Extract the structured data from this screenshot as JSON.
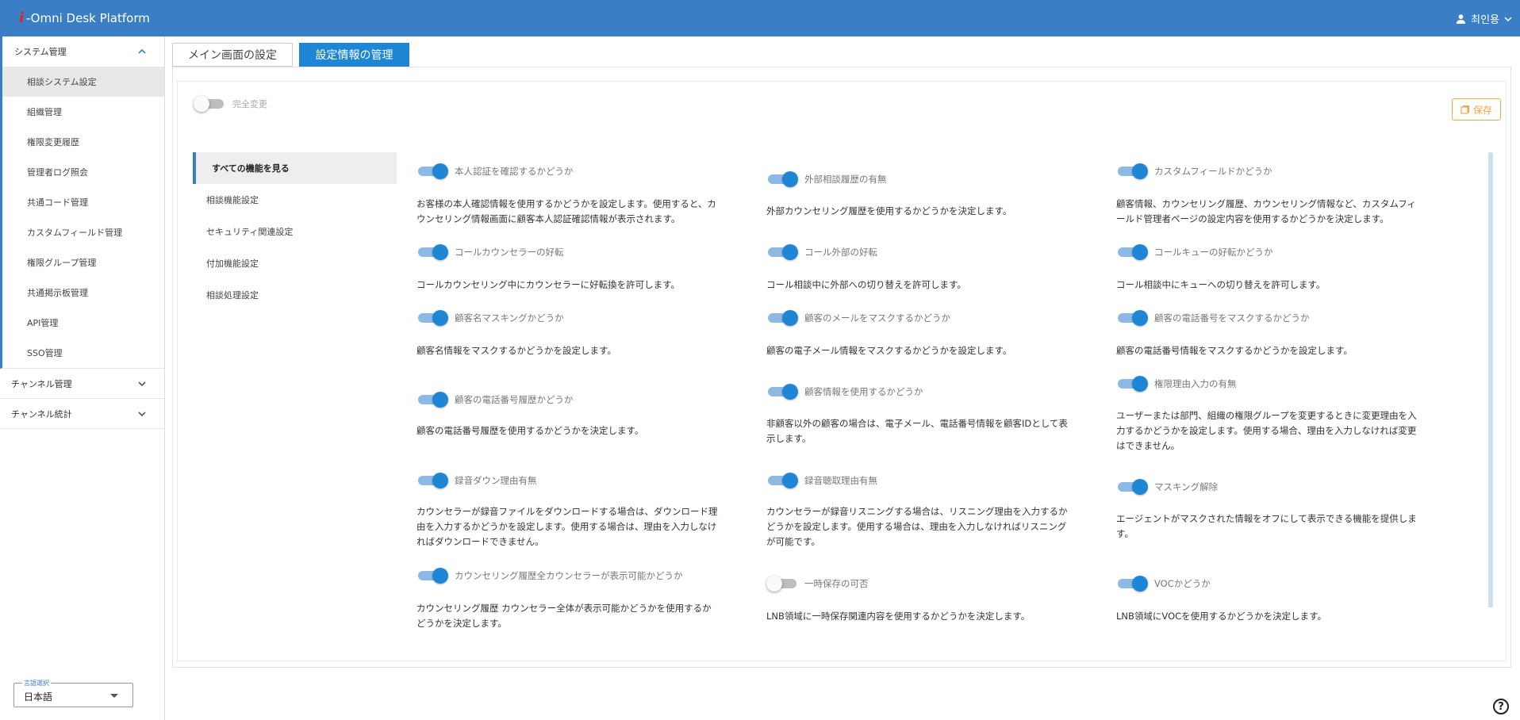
{
  "app": {
    "logo_mark": "i",
    "title": "-Omni Desk Platform",
    "user_name": "최인용"
  },
  "sidebar": {
    "groups": [
      {
        "label": "システム管理"
      },
      {
        "label": "チャンネル管理"
      },
      {
        "label": "チャンネル統計"
      }
    ],
    "items": [
      {
        "label": "相談システム設定"
      },
      {
        "label": "組織管理"
      },
      {
        "label": "権限変更履歴"
      },
      {
        "label": "管理者ログ照会"
      },
      {
        "label": "共通コード管理"
      },
      {
        "label": "カスタムフィールド管理"
      },
      {
        "label": "権限グループ管理"
      },
      {
        "label": "共通掲示板管理"
      },
      {
        "label": "API管理"
      },
      {
        "label": "SSO管理"
      }
    ],
    "language": {
      "label": "言語選択",
      "value": "日本語"
    }
  },
  "tabs": [
    {
      "label": "メイン画面の設定"
    },
    {
      "label": "設定情報の管理"
    }
  ],
  "toolbar": {
    "full_change_label": "完全変更",
    "full_change_on": false,
    "save_label": "保存"
  },
  "categories": [
    {
      "label": "すべての機能を見る"
    },
    {
      "label": "相談機能設定"
    },
    {
      "label": "セキュリティ関連設定"
    },
    {
      "label": "付加機能設定"
    },
    {
      "label": "相談処理設定"
    }
  ],
  "features": [
    {
      "title": "本人認証を確認するかどうか",
      "on": true,
      "desc": "お客様の本人確認情報を使用するかどうかを設定します。使用すると、カ\nウンセリング情報画面に顧客本人認証確認情報が表示されます。"
    },
    {
      "title": "外部相談履歴の有無",
      "on": true,
      "desc": "外部カウンセリング履歴を使用するかどうかを決定します。"
    },
    {
      "title": "カスタムフィールドかどうか",
      "on": true,
      "desc": "顧客情報、カウンセリング履歴、カウンセリング情報など、カスタムフィ\nールド管理者ページの設定内容を使用するかどうかを決定します。"
    },
    {
      "title": "コールカウンセラーの好転",
      "on": true,
      "desc": "コールカウンセリング中にカウンセラーに好転換を許可します。"
    },
    {
      "title": "コール外部の好転",
      "on": true,
      "desc": "コール相談中に外部への切り替えを許可します。"
    },
    {
      "title": "コールキューの好転かどうか",
      "on": true,
      "desc": "コール相談中にキューへの切り替えを許可します。"
    },
    {
      "title": "顧客名マスキングかどうか",
      "on": true,
      "desc": "顧客名情報をマスクするかどうかを設定します。"
    },
    {
      "title": "顧客のメールをマスクするかどうか",
      "on": true,
      "desc": "顧客の電子メール情報をマスクするかどうかを設定します。"
    },
    {
      "title": "顧客の電話番号をマスクするかどうか",
      "on": true,
      "desc": "顧客の電話番号情報をマスクするかどうかを設定します。"
    },
    {
      "title": "顧客の電話番号履歴かどうか",
      "on": true,
      "desc": "顧客の電話番号履歴を使用するかどうかを決定します。"
    },
    {
      "title": "顧客情報を使用するかどうか",
      "on": true,
      "desc": "非顧客以外の顧客の場合は、電子メール、電話番号情報を顧客IDとして表\n示します。"
    },
    {
      "title": "権限理由入力の有無",
      "on": true,
      "desc": "ユーザーまたは部門、組織の権限グループを変更するときに変更理由を入\n力するかどうかを設定します。使用する場合、理由を入力しなければ変更\nはできません。"
    },
    {
      "title": "録音ダウン理由有無",
      "on": true,
      "desc": "カウンセラーが録音ファイルをダウンロードする場合は、ダウンロード理\n由を入力するかどうかを設定します。使用する場合は、理由を入力しなけ\nればダウンロードできません。"
    },
    {
      "title": "録音聴取理由有無",
      "on": true,
      "desc": "カウンセラーが録音リスニングする場合は、リスニング理由を入力するか\nどうかを設定します。使用する場合は、理由を入力しなければリスニング\nが可能です。"
    },
    {
      "title": "マスキング解除",
      "on": true,
      "desc": "エージェントがマスクされた情報をオフにして表示できる機能を提供しま\nす。"
    },
    {
      "title": "カウンセリング履歴全カウンセラーが表示可能かどうか",
      "on": true,
      "desc": "カウンセリング履歴 カウンセラー全体が表示可能かどうかを使用するか\nどうかを決定します。"
    },
    {
      "title": "一時保存の可否",
      "on": false,
      "desc": "LNB領域に一時保存関連内容を使用するかどうかを決定します。"
    },
    {
      "title": "VOCかどうか",
      "on": true,
      "desc": "LNB領域にVOCを使用するかどうかを決定します。"
    }
  ],
  "icons": {
    "user": "user-icon",
    "chevron": "chevron-down-icon",
    "save": "copy-icon",
    "help": "help-icon"
  },
  "colors": {
    "header": "#3a7ec6",
    "active_tab": "#1f86d6",
    "toggle_on": "#1f86d6",
    "save": "#f0a64a"
  }
}
